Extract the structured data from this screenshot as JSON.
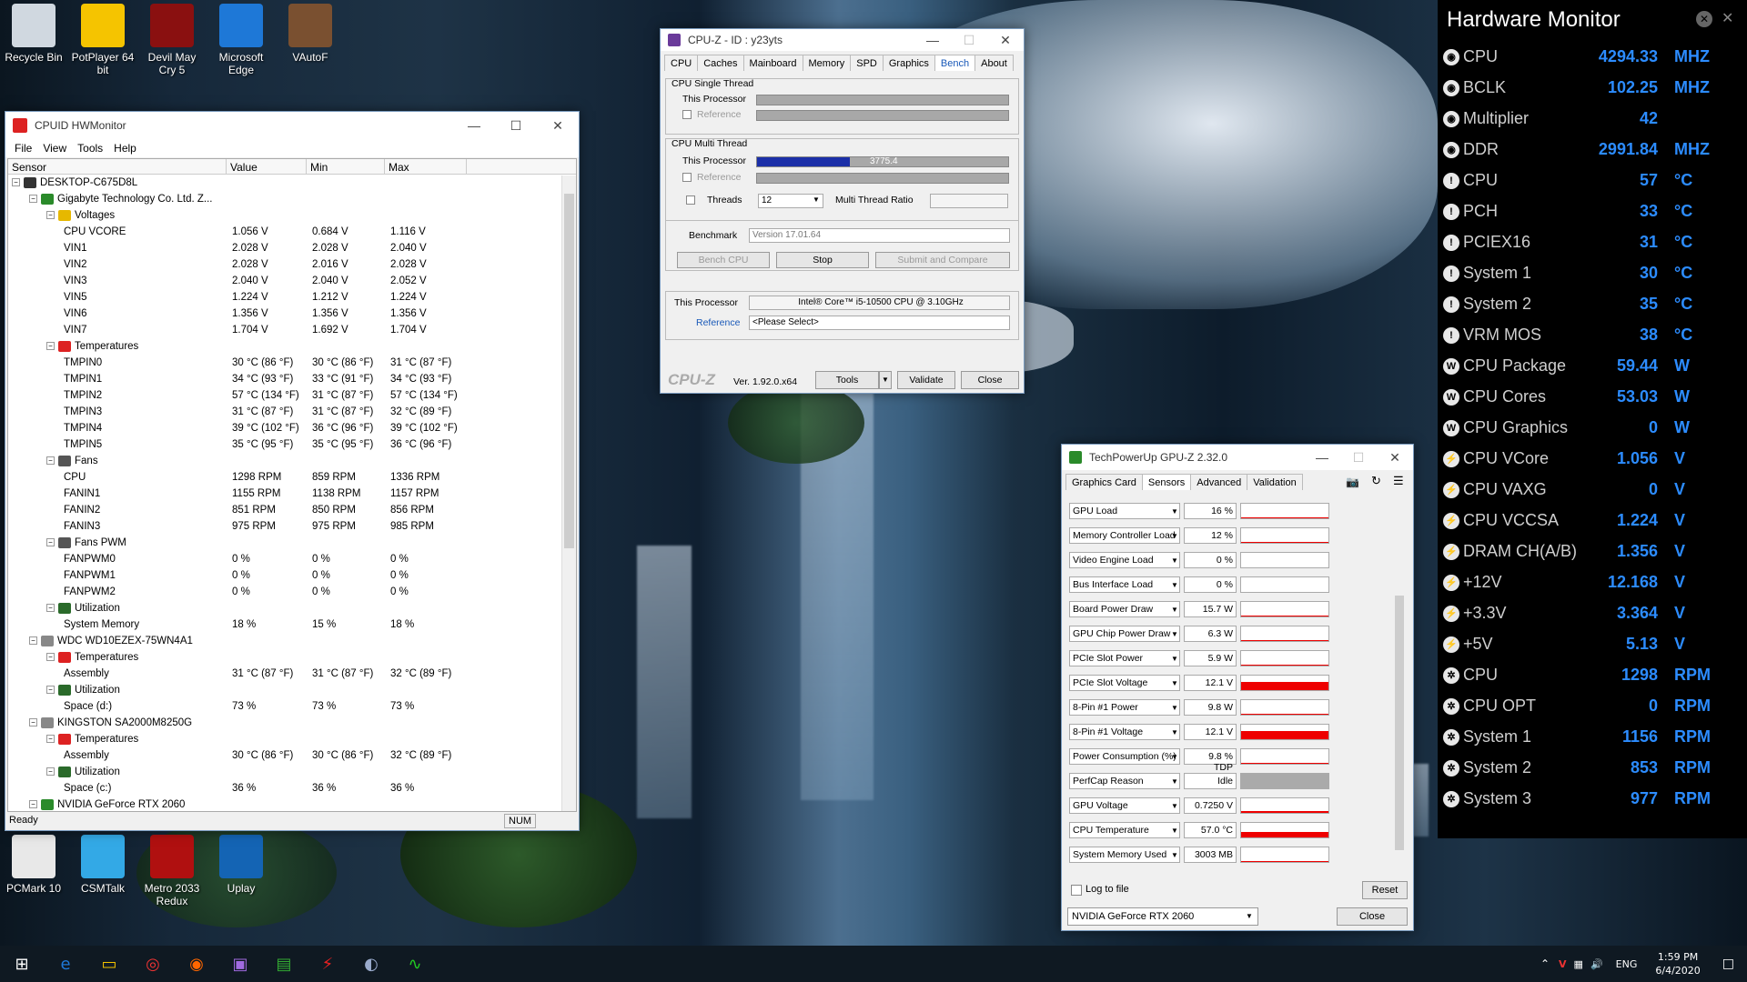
{
  "desktop_icons": [
    {
      "label": "Recycle Bin",
      "icon": "recycle-bin-icon",
      "color": "#d0d8e0"
    },
    {
      "label": "PotPlayer 64 bit",
      "icon": "potplayer-icon",
      "color": "#f5c400"
    },
    {
      "label": "Devil May Cry 5",
      "icon": "dmc5-icon",
      "color": "#8a1010"
    },
    {
      "label": "Microsoft Edge",
      "icon": "edge-icon",
      "color": "#1e78d7"
    },
    {
      "label": "VAutoF",
      "icon": "vautof-icon",
      "color": "#7a5030"
    },
    {
      "label": "PCMark 10",
      "icon": "pcmark-icon",
      "color": "#e8e8e8"
    },
    {
      "label": "CSMTalk",
      "icon": "csmtalk-icon",
      "color": "#33a9e6"
    },
    {
      "label": "Metro 2033 Redux",
      "icon": "metro-icon",
      "color": "#b01010"
    },
    {
      "label": "Uplay",
      "icon": "uplay-icon",
      "color": "#1464b4"
    }
  ],
  "hwmonitor": {
    "title": "CPUID HWMonitor",
    "menu": [
      "File",
      "View",
      "Tools",
      "Help"
    ],
    "columns": [
      "Sensor",
      "Value",
      "Min",
      "Max"
    ],
    "rows": [
      {
        "lvl": 0,
        "tog": "-",
        "icon": "computer",
        "name": "DESKTOP-C675D8L",
        "v": "",
        "mn": "",
        "mx": ""
      },
      {
        "lvl": 1,
        "tog": "-",
        "icon": "board",
        "name": "Gigabyte Technology Co. Ltd. Z...",
        "v": "",
        "mn": "",
        "mx": ""
      },
      {
        "lvl": 2,
        "tog": "-",
        "icon": "volt",
        "name": "Voltages",
        "v": "",
        "mn": "",
        "mx": ""
      },
      {
        "lvl": 3,
        "name": "CPU VCORE",
        "v": "1.056 V",
        "mn": "0.684 V",
        "mx": "1.116 V"
      },
      {
        "lvl": 3,
        "name": "VIN1",
        "v": "2.028 V",
        "mn": "2.028 V",
        "mx": "2.040 V"
      },
      {
        "lvl": 3,
        "name": "VIN2",
        "v": "2.028 V",
        "mn": "2.016 V",
        "mx": "2.028 V"
      },
      {
        "lvl": 3,
        "name": "VIN3",
        "v": "2.040 V",
        "mn": "2.040 V",
        "mx": "2.052 V"
      },
      {
        "lvl": 3,
        "name": "VIN5",
        "v": "1.224 V",
        "mn": "1.212 V",
        "mx": "1.224 V"
      },
      {
        "lvl": 3,
        "name": "VIN6",
        "v": "1.356 V",
        "mn": "1.356 V",
        "mx": "1.356 V"
      },
      {
        "lvl": 3,
        "name": "VIN7",
        "v": "1.704 V",
        "mn": "1.692 V",
        "mx": "1.704 V"
      },
      {
        "lvl": 2,
        "tog": "-",
        "icon": "temp",
        "name": "Temperatures",
        "v": "",
        "mn": "",
        "mx": ""
      },
      {
        "lvl": 3,
        "name": "TMPIN0",
        "v": "30 °C (86 °F)",
        "mn": "30 °C (86 °F)",
        "mx": "31 °C (87 °F)"
      },
      {
        "lvl": 3,
        "name": "TMPIN1",
        "v": "34 °C (93 °F)",
        "mn": "33 °C (91 °F)",
        "mx": "34 °C (93 °F)"
      },
      {
        "lvl": 3,
        "name": "TMPIN2",
        "v": "57 °C (134 °F)",
        "mn": "31 °C (87 °F)",
        "mx": "57 °C (134 °F)"
      },
      {
        "lvl": 3,
        "name": "TMPIN3",
        "v": "31 °C (87 °F)",
        "mn": "31 °C (87 °F)",
        "mx": "32 °C (89 °F)"
      },
      {
        "lvl": 3,
        "name": "TMPIN4",
        "v": "39 °C (102 °F)",
        "mn": "36 °C (96 °F)",
        "mx": "39 °C (102 °F)"
      },
      {
        "lvl": 3,
        "name": "TMPIN5",
        "v": "35 °C (95 °F)",
        "mn": "35 °C (95 °F)",
        "mx": "36 °C (96 °F)"
      },
      {
        "lvl": 2,
        "tog": "-",
        "icon": "fan",
        "name": "Fans",
        "v": "",
        "mn": "",
        "mx": ""
      },
      {
        "lvl": 3,
        "name": "CPU",
        "v": "1298 RPM",
        "mn": "859 RPM",
        "mx": "1336 RPM"
      },
      {
        "lvl": 3,
        "name": "FANIN1",
        "v": "1155 RPM",
        "mn": "1138 RPM",
        "mx": "1157 RPM"
      },
      {
        "lvl": 3,
        "name": "FANIN2",
        "v": "851 RPM",
        "mn": "850 RPM",
        "mx": "856 RPM"
      },
      {
        "lvl": 3,
        "name": "FANIN3",
        "v": "975 RPM",
        "mn": "975 RPM",
        "mx": "985 RPM"
      },
      {
        "lvl": 2,
        "tog": "-",
        "icon": "fan",
        "name": "Fans PWM",
        "v": "",
        "mn": "",
        "mx": ""
      },
      {
        "lvl": 3,
        "name": "FANPWM0",
        "v": "0 %",
        "mn": "0 %",
        "mx": "0 %"
      },
      {
        "lvl": 3,
        "name": "FANPWM1",
        "v": "0 %",
        "mn": "0 %",
        "mx": "0 %"
      },
      {
        "lvl": 3,
        "name": "FANPWM2",
        "v": "0 %",
        "mn": "0 %",
        "mx": "0 %"
      },
      {
        "lvl": 2,
        "tog": "-",
        "icon": "util",
        "name": "Utilization",
        "v": "",
        "mn": "",
        "mx": ""
      },
      {
        "lvl": 3,
        "name": "System Memory",
        "v": "18 %",
        "mn": "15 %",
        "mx": "18 %"
      },
      {
        "lvl": 1,
        "tog": "-",
        "icon": "disk",
        "name": "WDC WD10EZEX-75WN4A1",
        "v": "",
        "mn": "",
        "mx": ""
      },
      {
        "lvl": 2,
        "tog": "-",
        "icon": "temp",
        "name": "Temperatures",
        "v": "",
        "mn": "",
        "mx": ""
      },
      {
        "lvl": 3,
        "name": "Assembly",
        "v": "31 °C (87 °F)",
        "mn": "31 °C (87 °F)",
        "mx": "32 °C (89 °F)"
      },
      {
        "lvl": 2,
        "tog": "-",
        "icon": "util",
        "name": "Utilization",
        "v": "",
        "mn": "",
        "mx": ""
      },
      {
        "lvl": 3,
        "name": "Space (d:)",
        "v": "73 %",
        "mn": "73 %",
        "mx": "73 %"
      },
      {
        "lvl": 1,
        "tog": "-",
        "icon": "disk",
        "name": "KINGSTON SA2000M8250G",
        "v": "",
        "mn": "",
        "mx": ""
      },
      {
        "lvl": 2,
        "tog": "-",
        "icon": "temp",
        "name": "Temperatures",
        "v": "",
        "mn": "",
        "mx": ""
      },
      {
        "lvl": 3,
        "name": "Assembly",
        "v": "30 °C (86 °F)",
        "mn": "30 °C (86 °F)",
        "mx": "32 °C (89 °F)"
      },
      {
        "lvl": 2,
        "tog": "-",
        "icon": "util",
        "name": "Utilization",
        "v": "",
        "mn": "",
        "mx": ""
      },
      {
        "lvl": 3,
        "name": "Space (c:)",
        "v": "36 %",
        "mn": "36 %",
        "mx": "36 %"
      },
      {
        "lvl": 1,
        "tog": "-",
        "icon": "gpu",
        "name": "NVIDIA GeForce RTX 2060",
        "v": "",
        "mn": "",
        "mx": ""
      }
    ],
    "status": "Ready",
    "num": "NUM"
  },
  "cpuz": {
    "title": "CPU-Z - ID : y23yts",
    "tabs": [
      "CPU",
      "Caches",
      "Mainboard",
      "Memory",
      "SPD",
      "Graphics",
      "Bench",
      "About"
    ],
    "active_tab": "Bench",
    "single_thread": "CPU Single Thread",
    "multi_thread": "CPU Multi Thread",
    "this_processor": "This Processor",
    "reference": "Reference",
    "multi_score": "3775.4",
    "multi_fraction": 0.37,
    "threads_label": "Threads",
    "threads_value": "12",
    "ratio_label": "Multi Thread Ratio",
    "benchmark_label": "Benchmark",
    "benchmark_version": "Version 17.01.64",
    "bench_cpu": "Bench CPU",
    "stop": "Stop",
    "submit": "Submit and Compare",
    "this_processor_name": "Intel® Core™ i5-10500 CPU @ 3.10GHz",
    "reference_select": "<Please Select>",
    "brand": "CPU-Z",
    "version": "Ver. 1.92.0.x64",
    "tools": "Tools",
    "validate": "Validate",
    "close": "Close"
  },
  "gpuz": {
    "title": "TechPowerUp GPU-Z 2.32.0",
    "tabs": [
      "Graphics Card",
      "Sensors",
      "Advanced",
      "Validation"
    ],
    "active_tab": "Sensors",
    "sensors": [
      {
        "name": "GPU Load",
        "value": "16 %",
        "fill": 0.05
      },
      {
        "name": "Memory Controller Load",
        "value": "12 %",
        "fill": 0.04
      },
      {
        "name": "Video Engine Load",
        "value": "0 %",
        "fill": 0
      },
      {
        "name": "Bus Interface Load",
        "value": "0 %",
        "fill": 0
      },
      {
        "name": "Board Power Draw",
        "value": "15.7 W",
        "fill": 0.05
      },
      {
        "name": "GPU Chip Power Draw",
        "value": "6.3 W",
        "fill": 0.05
      },
      {
        "name": "PCIe Slot Power",
        "value": "5.9 W",
        "fill": 0.05
      },
      {
        "name": "PCIe Slot Voltage",
        "value": "12.1 V",
        "fill": 0.55
      },
      {
        "name": "8-Pin #1 Power",
        "value": "9.8 W",
        "fill": 0.05
      },
      {
        "name": "8-Pin #1 Voltage",
        "value": "12.1 V",
        "fill": 0.55
      },
      {
        "name": "Power Consumption (%)",
        "value": "9.8 % TDP",
        "fill": 0.05
      },
      {
        "name": "PerfCap Reason",
        "value": "Idle",
        "fill": 1,
        "gray": true
      },
      {
        "name": "GPU Voltage",
        "value": "0.7250 V",
        "fill": 0.1
      },
      {
        "name": "CPU Temperature",
        "value": "57.0 °C",
        "fill": 0.35
      },
      {
        "name": "System Memory Used",
        "value": "3003 MB",
        "fill": 0.05
      }
    ],
    "log_to_file": "Log to file",
    "reset": "Reset",
    "gpu_select": "NVIDIA GeForce RTX 2060",
    "close": "Close"
  },
  "hwpanel": {
    "title": "Hardware Monitor",
    "rows": [
      {
        "l": "CPU",
        "v": "4294.33",
        "u": "MHZ",
        "ic": "cpu"
      },
      {
        "l": "BCLK",
        "v": "102.25",
        "u": "MHZ",
        "ic": "cpu"
      },
      {
        "l": "Multiplier",
        "v": "42",
        "u": "",
        "ic": "cpu"
      },
      {
        "l": "DDR",
        "v": "2991.84",
        "u": "MHZ",
        "ic": "cpu"
      },
      {
        "l": "CPU",
        "v": "57",
        "u": "°C",
        "ic": "temp"
      },
      {
        "l": "PCH",
        "v": "33",
        "u": "°C",
        "ic": "temp"
      },
      {
        "l": "PCIEX16",
        "v": "31",
        "u": "°C",
        "ic": "temp"
      },
      {
        "l": "System 1",
        "v": "30",
        "u": "°C",
        "ic": "temp"
      },
      {
        "l": "System 2",
        "v": "35",
        "u": "°C",
        "ic": "temp"
      },
      {
        "l": "VRM MOS",
        "v": "38",
        "u": "°C",
        "ic": "temp"
      },
      {
        "l": "CPU Package",
        "v": "59.44",
        "u": "W",
        "ic": "power"
      },
      {
        "l": "CPU Cores",
        "v": "53.03",
        "u": "W",
        "ic": "power"
      },
      {
        "l": "CPU Graphics",
        "v": "0",
        "u": "W",
        "ic": "power"
      },
      {
        "l": "CPU VCore",
        "v": "1.056",
        "u": "V",
        "ic": "volt"
      },
      {
        "l": "CPU VAXG",
        "v": "0",
        "u": "V",
        "ic": "volt"
      },
      {
        "l": "CPU VCCSA",
        "v": "1.224",
        "u": "V",
        "ic": "volt"
      },
      {
        "l": "DRAM CH(A/B)",
        "v": "1.356",
        "u": "V",
        "ic": "volt"
      },
      {
        "l": "+12V",
        "v": "12.168",
        "u": "V",
        "ic": "volt"
      },
      {
        "l": "+3.3V",
        "v": "3.364",
        "u": "V",
        "ic": "volt"
      },
      {
        "l": "+5V",
        "v": "5.13",
        "u": "V",
        "ic": "volt"
      },
      {
        "l": "CPU",
        "v": "1298",
        "u": "RPM",
        "ic": "fan"
      },
      {
        "l": "CPU OPT",
        "v": "0",
        "u": "RPM",
        "ic": "fan"
      },
      {
        "l": "System 1",
        "v": "1156",
        "u": "RPM",
        "ic": "fan"
      },
      {
        "l": "System 2",
        "v": "853",
        "u": "RPM",
        "ic": "fan"
      },
      {
        "l": "System 3",
        "v": "977",
        "u": "RPM",
        "ic": "fan"
      }
    ]
  },
  "taskbar": {
    "apps": [
      "windows-start-icon",
      "edge-taskbar-icon",
      "file-explorer-icon",
      "chrome-icon",
      "firefox-icon",
      "cpuz-taskbar-icon",
      "gpuz-taskbar-icon",
      "hwmonitor-taskbar-icon",
      "taskbar-app-icon",
      "monitor-app-icon"
    ],
    "lang": "ENG",
    "time": "1:59 PM",
    "date": "6/4/2020"
  }
}
